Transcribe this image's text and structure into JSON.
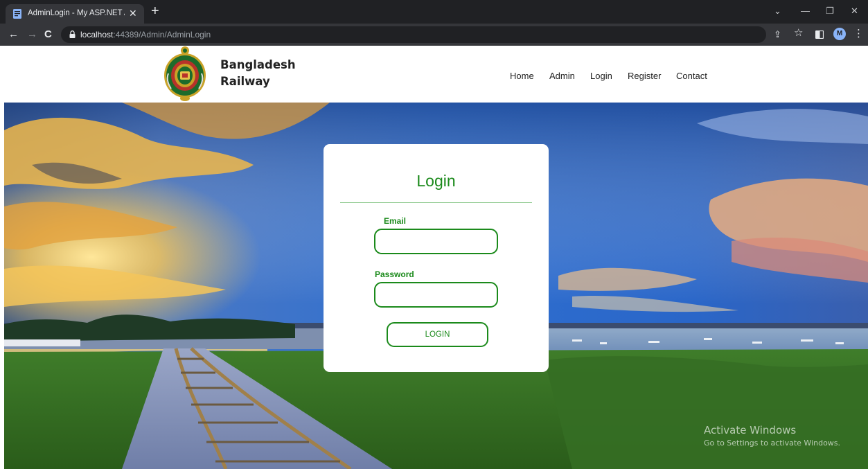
{
  "browser": {
    "tab_title": "AdminLogin - My ASP.NET Applic",
    "tab_close": "✕",
    "new_tab": "+",
    "url_host": "localhost",
    "url_rest": ":44389/Admin/AdminLogin",
    "profile_initial": "M",
    "controls": {
      "back": "←",
      "forward": "→",
      "reload": "C",
      "share": "⇪",
      "star": "☆",
      "menu": "⋮",
      "dropdown": "⌄",
      "minimize": "—",
      "restore": "❐",
      "close": "✕"
    }
  },
  "site": {
    "brand_line1": "Bangladesh",
    "brand_line2": "Railway",
    "nav": [
      "Home",
      "Admin",
      "Login",
      "Register",
      "Contact"
    ]
  },
  "login": {
    "title": "Login",
    "email_label": "Email",
    "password_label": "Password",
    "email_value": "",
    "password_value": "",
    "button_label": "LOGIN"
  },
  "watermark": {
    "line1": "Activate Windows",
    "line2": "Go to Settings to activate Windows."
  },
  "colors": {
    "accent_green": "#1b8a1b",
    "chrome_dark": "#202124",
    "chrome_mid": "#35363a"
  }
}
